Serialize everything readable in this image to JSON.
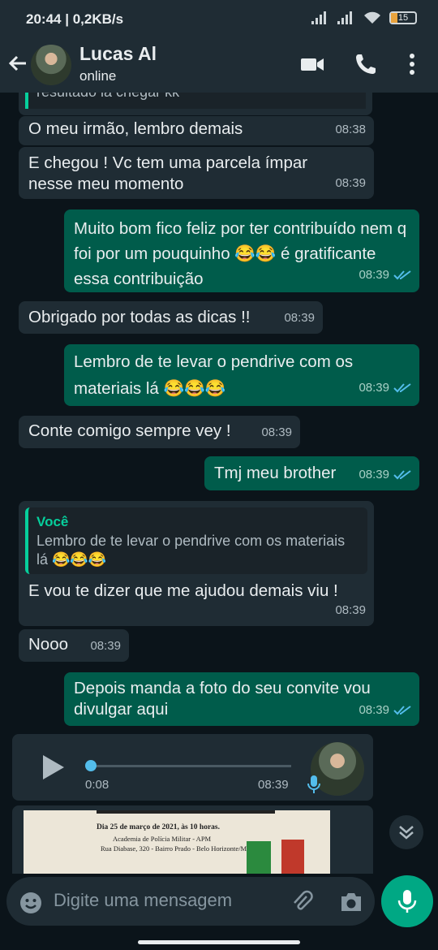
{
  "status_bar": {
    "time": "20:44",
    "info": "| 0,2KB/s",
    "battery": "15"
  },
  "header": {
    "name": "Lucas Al",
    "status": "online"
  },
  "top_quote_text": "resultado la chegar kk",
  "messages": [
    {
      "text": "O meu irmão, lembro demais",
      "time": "08:38",
      "dir": "in"
    },
    {
      "text": "E chegou ! Vc tem uma parcela ímpar nesse meu momento",
      "time": "08:39",
      "dir": "in"
    },
    {
      "text": "Muito bom fico feliz por ter contribuído nem q foi por um pouquinho 😂😂 é gratificante essa contribuição",
      "time": "08:39",
      "dir": "out"
    },
    {
      "text": "Obrigado por todas as dicas !!",
      "time": "08:39",
      "dir": "in"
    },
    {
      "text": "Lembro de te levar o pendrive com os materiais lá 😂😂😂",
      "time": "08:39",
      "dir": "out"
    },
    {
      "text": "Conte comigo sempre vey !",
      "time": "08:39",
      "dir": "in"
    },
    {
      "text": "Tmj meu brother",
      "time": "08:39",
      "dir": "out"
    },
    {
      "quote_name": "Você",
      "quote_text": "Lembro de te levar o pendrive com os materiais lá 😂😂😂",
      "text": "E vou te dizer que me ajudou demais viu !",
      "time": "08:39",
      "dir": "in"
    },
    {
      "text": "Nooo",
      "time": "08:39",
      "dir": "in"
    },
    {
      "text": "Depois manda a foto do seu convite vou divulgar aqui",
      "time": "08:39",
      "dir": "out"
    }
  ],
  "voice": {
    "duration": "0:08",
    "time": "08:39",
    "progress": 0
  },
  "image_doc": {
    "line1": "Dia 25 de março de 2021, às 10 horas.",
    "line2": "Academia de Polícia Militar - APM",
    "line3": "Rua Diabase, 320 - Bairro Prado - Belo Horizonte/MG"
  },
  "composer": {
    "placeholder": "Digite uma mensagem"
  },
  "colors": {
    "incoming": "#1f2c34",
    "outgoing": "#005c4b",
    "accent": "#00a884",
    "read_ticks": "#53bdeb"
  }
}
